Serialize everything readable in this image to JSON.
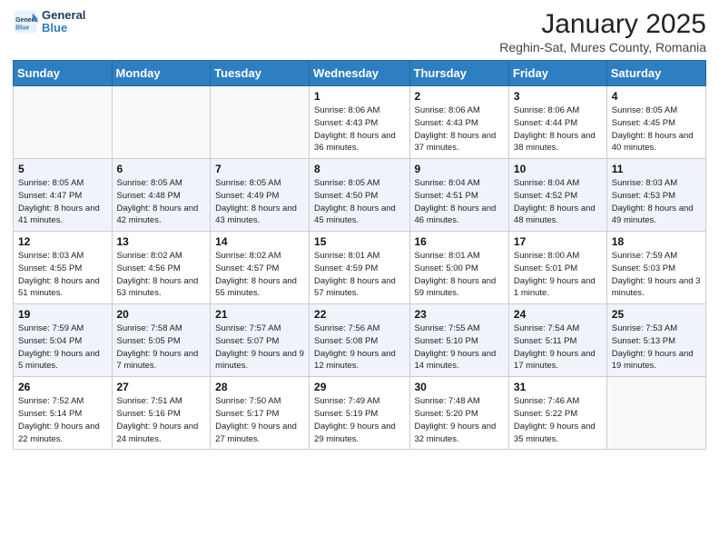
{
  "header": {
    "logo_line1": "General",
    "logo_line2": "Blue",
    "month": "January 2025",
    "location": "Reghin-Sat, Mures County, Romania"
  },
  "weekdays": [
    "Sunday",
    "Monday",
    "Tuesday",
    "Wednesday",
    "Thursday",
    "Friday",
    "Saturday"
  ],
  "weeks": [
    [
      {
        "day": "",
        "detail": ""
      },
      {
        "day": "",
        "detail": ""
      },
      {
        "day": "",
        "detail": ""
      },
      {
        "day": "1",
        "detail": "Sunrise: 8:06 AM\nSunset: 4:43 PM\nDaylight: 8 hours and 36 minutes."
      },
      {
        "day": "2",
        "detail": "Sunrise: 8:06 AM\nSunset: 4:43 PM\nDaylight: 8 hours and 37 minutes."
      },
      {
        "day": "3",
        "detail": "Sunrise: 8:06 AM\nSunset: 4:44 PM\nDaylight: 8 hours and 38 minutes."
      },
      {
        "day": "4",
        "detail": "Sunrise: 8:05 AM\nSunset: 4:45 PM\nDaylight: 8 hours and 40 minutes."
      }
    ],
    [
      {
        "day": "5",
        "detail": "Sunrise: 8:05 AM\nSunset: 4:47 PM\nDaylight: 8 hours and 41 minutes."
      },
      {
        "day": "6",
        "detail": "Sunrise: 8:05 AM\nSunset: 4:48 PM\nDaylight: 8 hours and 42 minutes."
      },
      {
        "day": "7",
        "detail": "Sunrise: 8:05 AM\nSunset: 4:49 PM\nDaylight: 8 hours and 43 minutes."
      },
      {
        "day": "8",
        "detail": "Sunrise: 8:05 AM\nSunset: 4:50 PM\nDaylight: 8 hours and 45 minutes."
      },
      {
        "day": "9",
        "detail": "Sunrise: 8:04 AM\nSunset: 4:51 PM\nDaylight: 8 hours and 46 minutes."
      },
      {
        "day": "10",
        "detail": "Sunrise: 8:04 AM\nSunset: 4:52 PM\nDaylight: 8 hours and 48 minutes."
      },
      {
        "day": "11",
        "detail": "Sunrise: 8:03 AM\nSunset: 4:53 PM\nDaylight: 8 hours and 49 minutes."
      }
    ],
    [
      {
        "day": "12",
        "detail": "Sunrise: 8:03 AM\nSunset: 4:55 PM\nDaylight: 8 hours and 51 minutes."
      },
      {
        "day": "13",
        "detail": "Sunrise: 8:02 AM\nSunset: 4:56 PM\nDaylight: 8 hours and 53 minutes."
      },
      {
        "day": "14",
        "detail": "Sunrise: 8:02 AM\nSunset: 4:57 PM\nDaylight: 8 hours and 55 minutes."
      },
      {
        "day": "15",
        "detail": "Sunrise: 8:01 AM\nSunset: 4:59 PM\nDaylight: 8 hours and 57 minutes."
      },
      {
        "day": "16",
        "detail": "Sunrise: 8:01 AM\nSunset: 5:00 PM\nDaylight: 8 hours and 59 minutes."
      },
      {
        "day": "17",
        "detail": "Sunrise: 8:00 AM\nSunset: 5:01 PM\nDaylight: 9 hours and 1 minute."
      },
      {
        "day": "18",
        "detail": "Sunrise: 7:59 AM\nSunset: 5:03 PM\nDaylight: 9 hours and 3 minutes."
      }
    ],
    [
      {
        "day": "19",
        "detail": "Sunrise: 7:59 AM\nSunset: 5:04 PM\nDaylight: 9 hours and 5 minutes."
      },
      {
        "day": "20",
        "detail": "Sunrise: 7:58 AM\nSunset: 5:05 PM\nDaylight: 9 hours and 7 minutes."
      },
      {
        "day": "21",
        "detail": "Sunrise: 7:57 AM\nSunset: 5:07 PM\nDaylight: 9 hours and 9 minutes."
      },
      {
        "day": "22",
        "detail": "Sunrise: 7:56 AM\nSunset: 5:08 PM\nDaylight: 9 hours and 12 minutes."
      },
      {
        "day": "23",
        "detail": "Sunrise: 7:55 AM\nSunset: 5:10 PM\nDaylight: 9 hours and 14 minutes."
      },
      {
        "day": "24",
        "detail": "Sunrise: 7:54 AM\nSunset: 5:11 PM\nDaylight: 9 hours and 17 minutes."
      },
      {
        "day": "25",
        "detail": "Sunrise: 7:53 AM\nSunset: 5:13 PM\nDaylight: 9 hours and 19 minutes."
      }
    ],
    [
      {
        "day": "26",
        "detail": "Sunrise: 7:52 AM\nSunset: 5:14 PM\nDaylight: 9 hours and 22 minutes."
      },
      {
        "day": "27",
        "detail": "Sunrise: 7:51 AM\nSunset: 5:16 PM\nDaylight: 9 hours and 24 minutes."
      },
      {
        "day": "28",
        "detail": "Sunrise: 7:50 AM\nSunset: 5:17 PM\nDaylight: 9 hours and 27 minutes."
      },
      {
        "day": "29",
        "detail": "Sunrise: 7:49 AM\nSunset: 5:19 PM\nDaylight: 9 hours and 29 minutes."
      },
      {
        "day": "30",
        "detail": "Sunrise: 7:48 AM\nSunset: 5:20 PM\nDaylight: 9 hours and 32 minutes."
      },
      {
        "day": "31",
        "detail": "Sunrise: 7:46 AM\nSunset: 5:22 PM\nDaylight: 9 hours and 35 minutes."
      },
      {
        "day": "",
        "detail": ""
      }
    ]
  ]
}
